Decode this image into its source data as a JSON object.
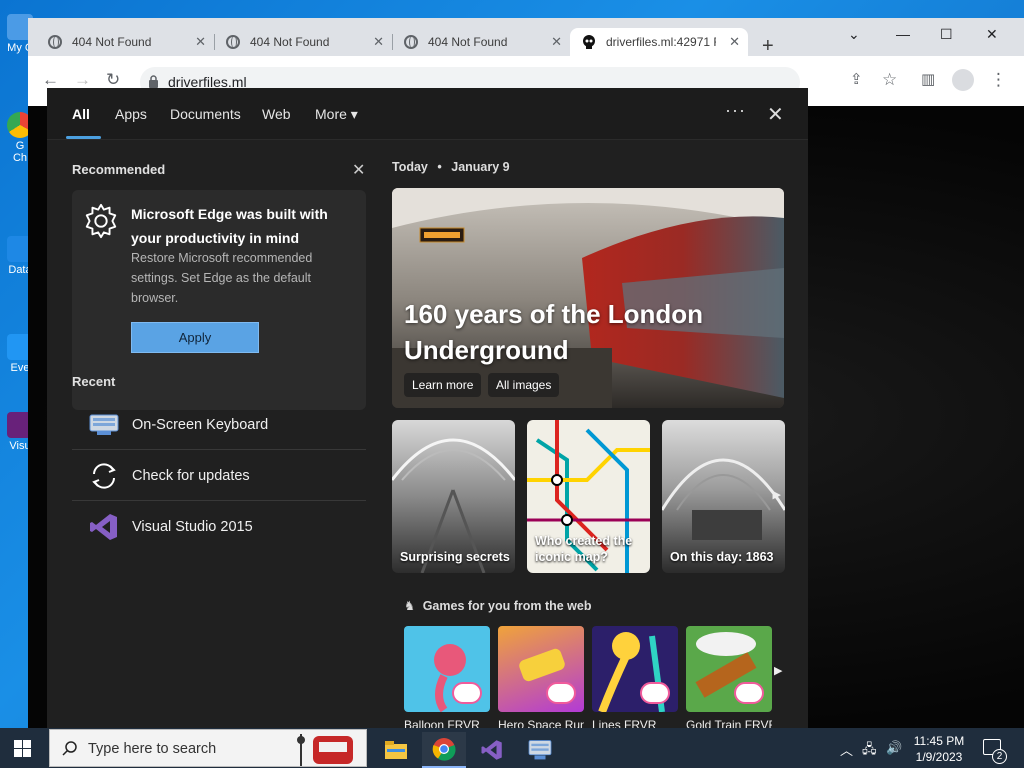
{
  "desktop": {
    "icons": [
      {
        "label": "My C",
        "color": "#2e7bd6"
      },
      {
        "label": "G\nCh",
        "color": "#34a853"
      },
      {
        "label": "Data",
        "color": "#1e88e5"
      },
      {
        "label": "Eve",
        "color": "#2196f3"
      },
      {
        "label": "Visu",
        "color": "#68217a"
      }
    ]
  },
  "browser": {
    "tabs": [
      {
        "title": "404 Not Found",
        "icon": "globe-icon"
      },
      {
        "title": "404 Not Found",
        "icon": "globe-icon"
      },
      {
        "title": "404 Not Found",
        "icon": "globe-icon"
      },
      {
        "title": "driverfiles.ml:42971 F",
        "icon": "skull-icon",
        "active": true
      }
    ],
    "new_tab": "+",
    "url": "driverfiles.ml",
    "window_controls": [
      "chevron-down-icon",
      "minimize-icon",
      "maximize-icon",
      "close-icon"
    ]
  },
  "panel": {
    "tabs": [
      "All",
      "Apps",
      "Documents",
      "Web",
      "More"
    ],
    "more_arrow": "▾",
    "dots": "···",
    "close": "✕",
    "recommended": {
      "heading": "Recommended",
      "card_title": "Microsoft Edge was built with your productivity in mind",
      "card_desc": "Restore Microsoft recommended settings. Set Edge as the default browser.",
      "apply": "Apply"
    },
    "recent": {
      "heading": "Recent",
      "items": [
        {
          "label": "On-Screen Keyboard",
          "icon": "keyboard-icon"
        },
        {
          "label": "Check for updates",
          "icon": "sync-icon"
        },
        {
          "label": "Visual Studio 2015",
          "icon": "visual-studio-icon"
        }
      ]
    },
    "news": {
      "date_prefix": "Today",
      "bullet": "•",
      "date": "January 9",
      "hero_title": "160 years of the London Underground",
      "learn_more": "Learn more",
      "all_images": "All images",
      "thumbs": [
        {
          "caption": "Surprising secrets"
        },
        {
          "caption": "Who created the iconic map?"
        },
        {
          "caption": "On this day: 1863"
        }
      ],
      "games_heading": "Games for you from the web",
      "games": [
        {
          "label": "Balloon FRVR",
          "color": "#4fc3e8"
        },
        {
          "label": "Hero Space Run",
          "color": "#b23ad6"
        },
        {
          "label": "Lines FRVR",
          "color": "#2c1f6a"
        },
        {
          "label": "Gold Train FRVR",
          "color": "#5aa84a"
        }
      ]
    }
  },
  "taskbar": {
    "search_placeholder": "Type here to search",
    "time": "11:45 PM",
    "date": "1/9/2023",
    "notification_count": "2",
    "apps": [
      "file-explorer-icon",
      "chrome-icon",
      "visual-studio-icon",
      "on-screen-keyboard-icon"
    ]
  }
}
